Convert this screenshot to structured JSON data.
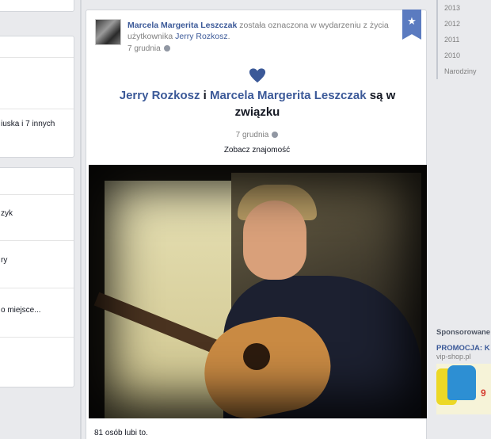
{
  "left": {
    "card1_rows": [
      "",
      "",
      "iuska i 7 innych"
    ],
    "card2_rows": [
      "",
      "zyk",
      "ry",
      "o miejsce..."
    ]
  },
  "post": {
    "author": "Marcela Margerita Leszczak",
    "action_text": " została oznaczona w wydarzeniu z życia użytkownika ",
    "tagged_user": "Jerry Rozkosz",
    "period": ".",
    "date": "7 grudnia",
    "badge_icon": "star-icon",
    "event": {
      "person1": "Jerry Rozkosz",
      "conjunction": " i ",
      "person2": "Marcela Margerita Leszczak",
      "suffix": " są w związku",
      "date": "7 grudnia",
      "see_friendship": "Zobacz znajomość"
    },
    "likes": "81 osób lubi to."
  },
  "sidebar": {
    "years": [
      "2013",
      "2012",
      "2011",
      "2010",
      "Narodziny"
    ]
  },
  "ads": {
    "section_title": "Sponsorowane",
    "ad_title": "PROMOCJA: K",
    "ad_url": "vip-shop.pl",
    "ad_price": "9"
  },
  "colors": {
    "link": "#3b5998",
    "badge": "#5b7bc0",
    "heart": "#3b5998",
    "background": "#e9eaed"
  }
}
